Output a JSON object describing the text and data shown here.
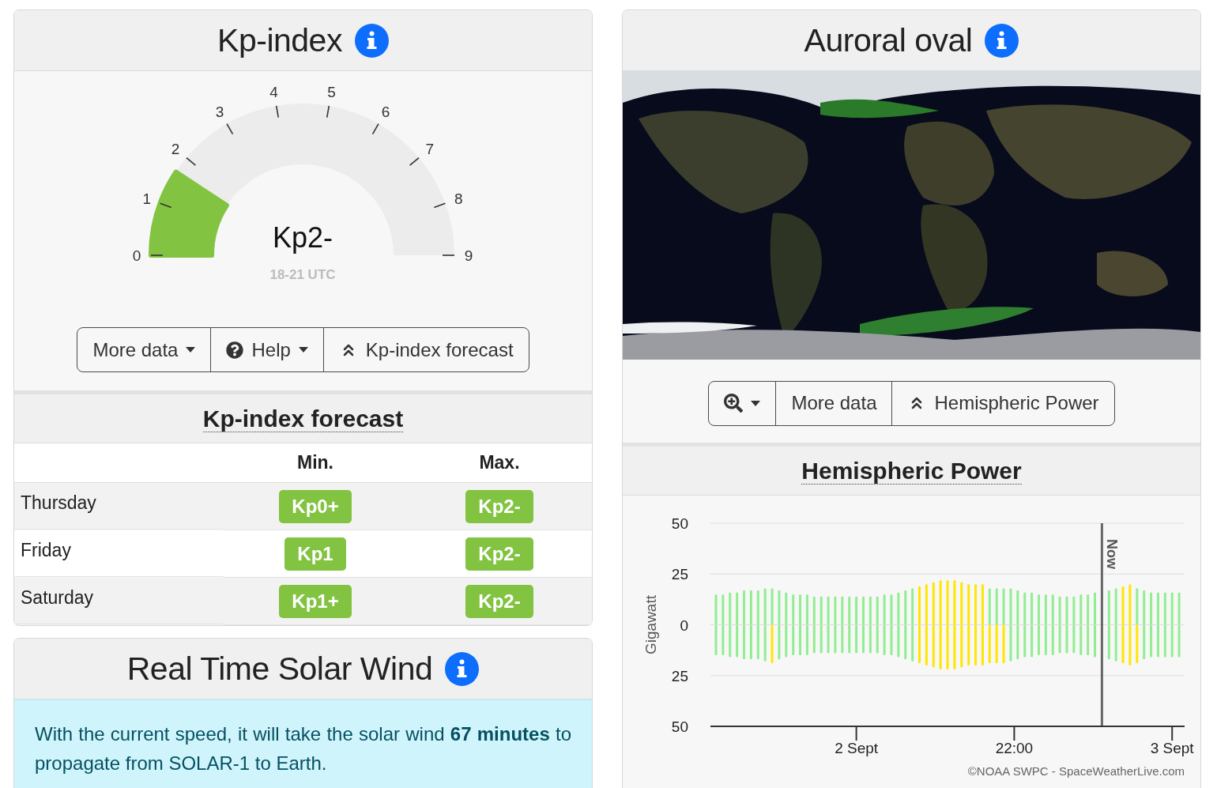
{
  "kp_panel": {
    "title": "Kp-index",
    "gauge": {
      "ticks": [
        "0",
        "1",
        "2",
        "3",
        "4",
        "5",
        "6",
        "7",
        "8",
        "9"
      ],
      "level": 0.185,
      "value": "Kp2-",
      "period": "18-21 UTC"
    },
    "buttons": [
      {
        "label": "More data",
        "kind": "dropdown"
      },
      {
        "label": "Help",
        "kind": "help"
      },
      {
        "label": "Kp-index forecast",
        "kind": "jump"
      }
    ]
  },
  "forecast": {
    "title": "Kp-index forecast",
    "columns": [
      "Min.",
      "Max."
    ],
    "rows": [
      {
        "day": "Thursday",
        "min": "Kp0+",
        "max": "Kp2-"
      },
      {
        "day": "Friday",
        "min": "Kp1",
        "max": "Kp2-"
      },
      {
        "day": "Saturday",
        "min": "Kp1+",
        "max": "Kp2-"
      }
    ]
  },
  "solar_wind": {
    "title": "Real Time Solar Wind",
    "message": "With the current speed, it will take the solar wind **67 minutes** to propagate from SOLAR-1 to Earth."
  },
  "auroral_oval": {
    "title": "Auroral oval",
    "buttons": [
      {
        "kind": "zoom"
      },
      {
        "label": "More data",
        "kind": "plain"
      },
      {
        "label": "Hemispheric Power",
        "kind": "jump"
      }
    ]
  },
  "hemispheric_power": {
    "title": "Hemispheric Power",
    "credit": "©NOAA SWPC - SpaceWeatherLive.com",
    "time_labels": [
      "2 Sept",
      "22:00",
      "3 Sept"
    ],
    "now_label": "Now",
    "chart_data": {
      "type": "bar",
      "ylabel": "Gigawatt",
      "stacked": true,
      "grid": true,
      "ylim": [
        -50,
        50
      ],
      "yticks": [
        {
          "value": 50,
          "label": "50"
        },
        {
          "value": 25,
          "label": "25"
        },
        {
          "value": 0,
          "label": "0"
        },
        {
          "value": -25,
          "label": "25"
        },
        {
          "value": -50,
          "label": "50"
        }
      ],
      "series": [
        {
          "color": "#90ee90",
          "values": [
            15,
            15,
            16,
            16,
            17,
            17,
            17,
            18,
            18,
            17,
            16,
            15,
            15,
            15,
            14,
            14,
            14,
            14,
            14,
            14,
            14,
            14,
            14,
            14,
            15,
            15,
            16,
            17,
            18,
            null,
            null,
            null,
            null,
            null,
            null,
            null,
            null,
            null,
            null,
            18,
            18,
            18,
            18,
            17,
            16,
            16,
            15,
            15,
            15,
            14,
            14,
            14,
            15,
            15,
            16,
            null,
            17,
            18,
            null,
            null,
            18,
            17,
            16,
            16,
            16,
            16,
            16
          ]
        },
        {
          "color": "#ffe600",
          "values": [
            null,
            null,
            null,
            null,
            null,
            null,
            null,
            null,
            null,
            null,
            null,
            null,
            null,
            null,
            null,
            null,
            null,
            null,
            null,
            null,
            null,
            null,
            null,
            null,
            null,
            null,
            null,
            null,
            null,
            19,
            20,
            21,
            22,
            22,
            22,
            21,
            20,
            20,
            20,
            null,
            null,
            null,
            null,
            null,
            null,
            null,
            null,
            null,
            null,
            null,
            null,
            null,
            null,
            null,
            null,
            null,
            null,
            null,
            19,
            20,
            null,
            null,
            null,
            null,
            null,
            null,
            null
          ]
        },
        {
          "color": "#90ee90",
          "values": [
            -15,
            -15,
            -16,
            -16,
            -17,
            -17,
            -17,
            -18,
            null,
            -17,
            -16,
            -15,
            -15,
            -15,
            -14,
            -14,
            -14,
            -14,
            -14,
            -14,
            -14,
            -14,
            -14,
            -14,
            -15,
            -15,
            -16,
            -17,
            -18,
            null,
            null,
            null,
            null,
            null,
            null,
            null,
            null,
            null,
            null,
            null,
            null,
            null,
            -18,
            -17,
            -16,
            -16,
            -15,
            -15,
            -15,
            -14,
            -14,
            -14,
            -15,
            -15,
            -16,
            null,
            -17,
            -18,
            null,
            null,
            null,
            -17,
            -16,
            -16,
            -16,
            -16,
            -16
          ]
        },
        {
          "color": "#ffe600",
          "values": [
            null,
            null,
            null,
            null,
            null,
            null,
            null,
            null,
            -19,
            null,
            null,
            null,
            null,
            null,
            null,
            null,
            null,
            null,
            null,
            null,
            null,
            null,
            null,
            null,
            null,
            null,
            null,
            null,
            null,
            -19,
            -20,
            -21,
            -22,
            -22,
            -22,
            -21,
            -20,
            -20,
            -20,
            -19,
            -19,
            -19,
            null,
            null,
            null,
            null,
            null,
            null,
            null,
            null,
            null,
            null,
            null,
            null,
            null,
            null,
            null,
            null,
            -19,
            -20,
            -19,
            null,
            null,
            null,
            null,
            null,
            null
          ]
        }
      ]
    }
  }
}
